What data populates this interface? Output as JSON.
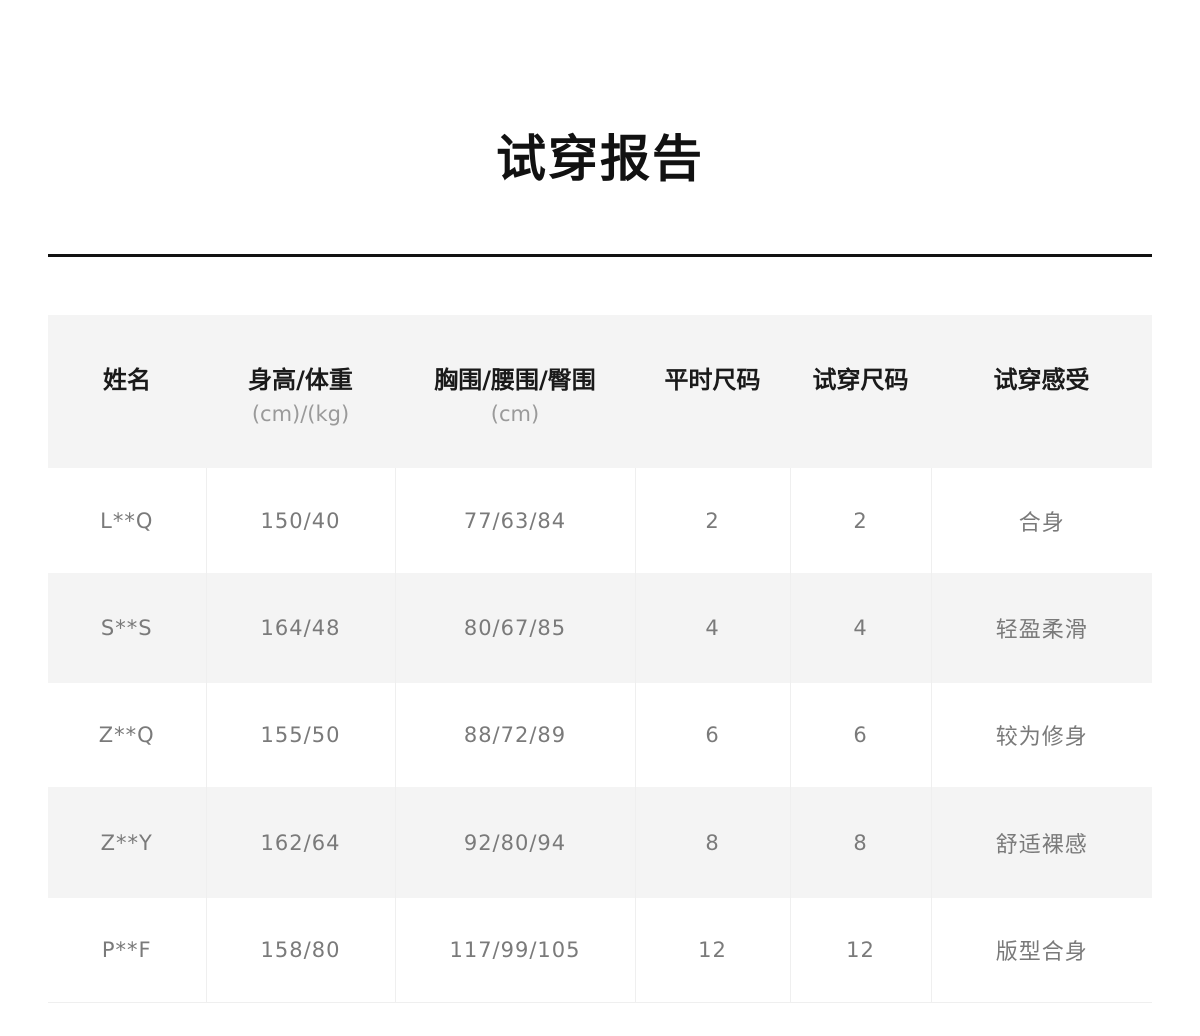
{
  "title": "试穿报告",
  "table": {
    "headers": [
      {
        "main": "姓名",
        "sub": ""
      },
      {
        "main": "身高/体重",
        "sub": "(cm)/(kg)"
      },
      {
        "main": "胸围/腰围/臀围",
        "sub": "(cm)"
      },
      {
        "main": "平时尺码",
        "sub": ""
      },
      {
        "main": "试穿尺码",
        "sub": ""
      },
      {
        "main": "试穿感受",
        "sub": ""
      }
    ],
    "rows": [
      [
        "L**Q",
        "150/40",
        "77/63/84",
        "2",
        "2",
        "合身"
      ],
      [
        "S**S",
        "164/48",
        "80/67/85",
        "4",
        "4",
        "轻盈柔滑"
      ],
      [
        "Z**Q",
        "155/50",
        "88/72/89",
        "6",
        "6",
        "较为修身"
      ],
      [
        "Z**Y",
        "162/64",
        "92/80/94",
        "8",
        "8",
        "舒适裸感"
      ],
      [
        "P**F",
        "158/80",
        "117/99/105",
        "12",
        "12",
        "版型合身"
      ]
    ]
  }
}
